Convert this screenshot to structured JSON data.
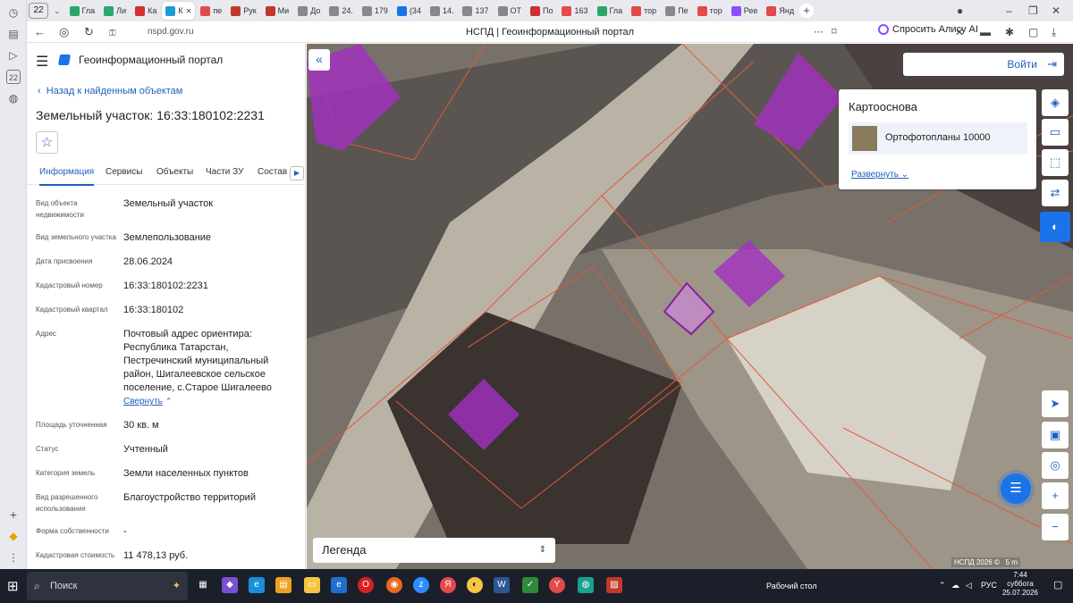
{
  "browser": {
    "tab_count": "22",
    "tabs": [
      {
        "label": "Гла",
        "color": "#2aa86b"
      },
      {
        "label": "Ли",
        "color": "#2aa86b"
      },
      {
        "label": "Ка",
        "color": "#d03030"
      },
      {
        "label": "К",
        "color": "#1a9bd8",
        "active": true
      },
      {
        "label": "пе",
        "color": "#e34a4a"
      },
      {
        "label": "Рук",
        "color": "#c0392b"
      },
      {
        "label": "Ми",
        "color": "#c0392b"
      },
      {
        "label": "До",
        "color": "#888888"
      },
      {
        "label": "24.",
        "color": "#888888"
      },
      {
        "label": "179",
        "color": "#888888"
      },
      {
        "label": "(34",
        "color": "#1a73e8"
      },
      {
        "label": "14.",
        "color": "#888888"
      },
      {
        "label": "137",
        "color": "#888888"
      },
      {
        "label": "ОТ",
        "color": "#888888"
      },
      {
        "label": "По",
        "color": "#d03030"
      },
      {
        "label": "163",
        "color": "#e34a4a"
      },
      {
        "label": "Гла",
        "color": "#2aa86b"
      },
      {
        "label": "тор",
        "color": "#e34a4a"
      },
      {
        "label": "Пе",
        "color": "#888888"
      },
      {
        "label": "тор",
        "color": "#e34a4a"
      },
      {
        "label": "Рее",
        "color": "#8a4dff"
      },
      {
        "label": "Янд",
        "color": "#e34a4a"
      }
    ],
    "url": "nspd.gov.ru",
    "page_title": "НСПД | Геоинформационный портал",
    "alice_label": "Спросить Алису AI"
  },
  "panel": {
    "portal_name": "Геоинформационный портал",
    "back_link": "Назад к найденным объектам",
    "title": "Земельный участок: 16:33:180102:2231",
    "tabs": [
      "Информация",
      "Сервисы",
      "Объекты",
      "Части ЗУ",
      "Состав"
    ],
    "properties": [
      {
        "label": "Вид объекта недвижимости",
        "value": "Земельный участок"
      },
      {
        "label": "Вид земельного участка",
        "value": "Землепользование"
      },
      {
        "label": "Дата присвоения",
        "value": "28.06.2024"
      },
      {
        "label": "Кадастровый номер",
        "value": "16:33:180102:2231"
      },
      {
        "label": "Кадастровый квартал",
        "value": "16:33:180102"
      },
      {
        "label": "Адрес",
        "value": "Почтовый адрес ориентира: Республика Татарстан, Пестречинский муниципальный район, Шигалеевское сельское поселение, с.Старое Шигалеево"
      },
      {
        "label": "Площадь уточненная",
        "value": "30 кв. м"
      },
      {
        "label": "Статус",
        "value": "Учтенный"
      },
      {
        "label": "Категория земель",
        "value": "Земли населенных пунктов"
      },
      {
        "label": "Вид разрешенного использования",
        "value": "Благоустройство территорий"
      },
      {
        "label": "Форма собственности",
        "value": "-"
      },
      {
        "label": "Кадастровая стоимость",
        "value": "11 478,13 руб."
      }
    ],
    "collapse_link": "Свернуть"
  },
  "map": {
    "login_label": "Войти",
    "basemap_title": "Картооснова",
    "basemap_item": "Ортофотопланы 10000",
    "expand_label": "Развернуть",
    "legend_label": "Легенда",
    "credit": "НСПД 2026 ©",
    "scale": "5 m",
    "highlight_color": "#a22fc0"
  },
  "taskbar": {
    "search_placeholder": "Поиск",
    "desktop_label": "Рабочий стол",
    "language": "РУС",
    "time": "7:44",
    "weekday": "суббота",
    "date": "25.07.2026"
  }
}
